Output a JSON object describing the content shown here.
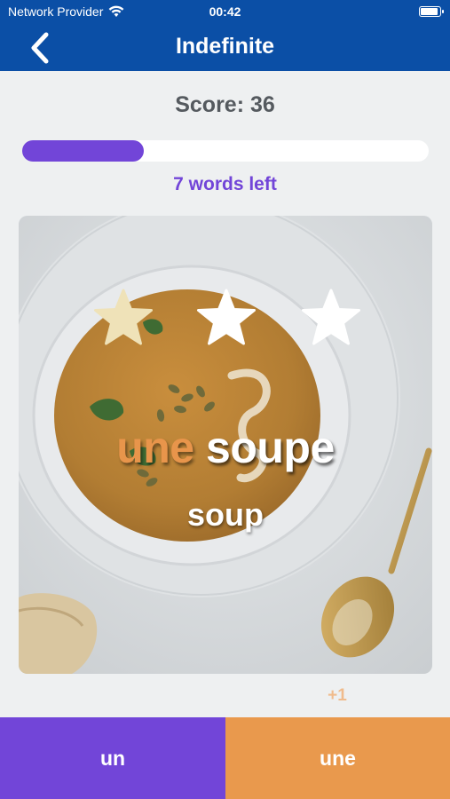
{
  "status_bar": {
    "carrier": "Network Provider",
    "time": "00:42"
  },
  "header": {
    "title": "Indefinite",
    "back_icon": "chevron-left-icon"
  },
  "quiz": {
    "score_label": "Score: 36",
    "progress": 0.3,
    "words_left_label": "7 words left",
    "stars_earned": 1,
    "stars_total": 3,
    "word": {
      "article": "une",
      "noun": "soupe",
      "translation": "soup"
    },
    "feedback": "+1"
  },
  "answers": [
    {
      "label": "un"
    },
    {
      "label": "une"
    }
  ],
  "colors": {
    "nav": "#0b4fa6",
    "accent_purple": "#7245d8",
    "accent_orange": "#e9994d",
    "star_filled": "#efe2b8",
    "star_empty": "#ffffff"
  }
}
